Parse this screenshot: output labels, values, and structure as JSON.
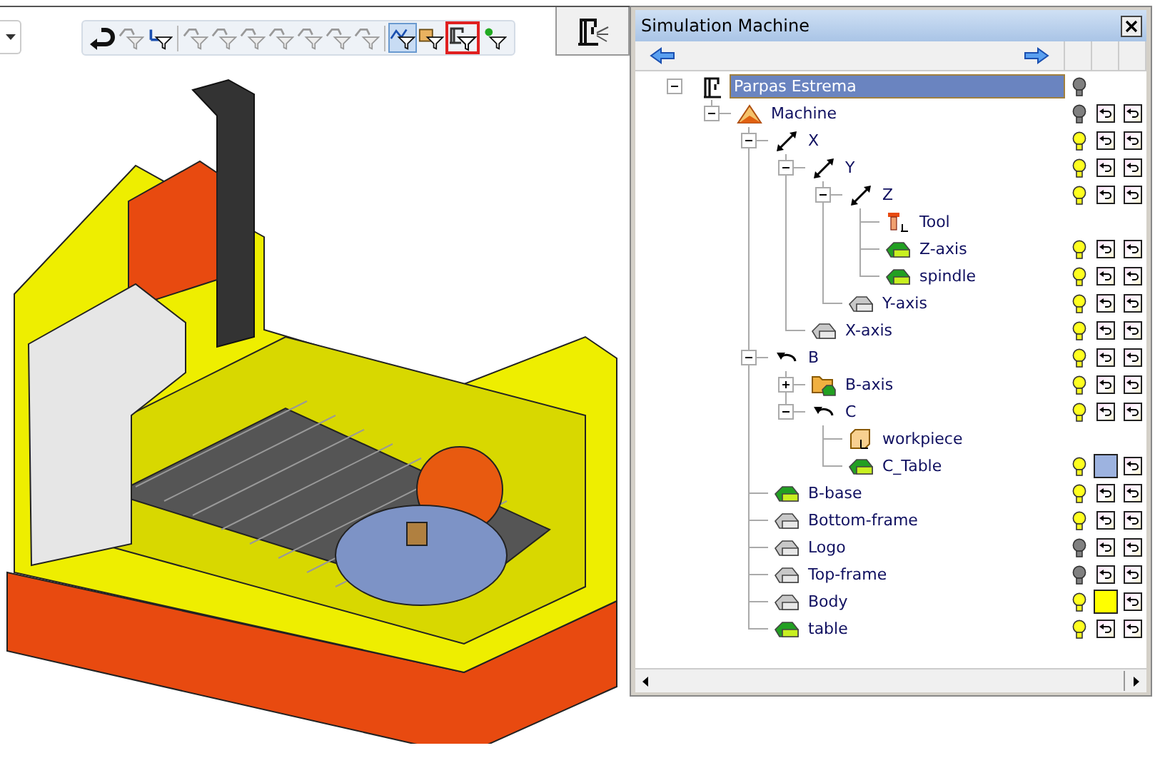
{
  "toolbar": {
    "buttons": [
      {
        "kind": "undo",
        "disabled": false,
        "pressed": false,
        "highlighted": false
      },
      {
        "kind": "filter",
        "disabled": true,
        "pressed": false,
        "highlighted": false
      },
      {
        "kind": "filter-axes",
        "disabled": false,
        "pressed": false,
        "highlighted": false
      },
      {
        "kind": "separator"
      },
      {
        "kind": "filter",
        "disabled": true,
        "pressed": false,
        "highlighted": false
      },
      {
        "kind": "filter",
        "disabled": true,
        "pressed": false,
        "highlighted": false
      },
      {
        "kind": "filter",
        "disabled": true,
        "pressed": false,
        "highlighted": false
      },
      {
        "kind": "filter",
        "disabled": true,
        "pressed": false,
        "highlighted": false
      },
      {
        "kind": "filter",
        "disabled": true,
        "pressed": false,
        "highlighted": false
      },
      {
        "kind": "filter",
        "disabled": true,
        "pressed": false,
        "highlighted": false
      },
      {
        "kind": "filter",
        "disabled": true,
        "pressed": false,
        "highlighted": false
      },
      {
        "kind": "separator"
      },
      {
        "kind": "filter-path",
        "disabled": false,
        "pressed": true,
        "highlighted": false
      },
      {
        "kind": "filter-box",
        "disabled": false,
        "pressed": false,
        "highlighted": false
      },
      {
        "kind": "filter-machine",
        "disabled": false,
        "pressed": false,
        "highlighted": true
      },
      {
        "kind": "filter-point",
        "disabled": false,
        "pressed": false,
        "highlighted": false
      }
    ]
  },
  "panel": {
    "title": "Simulation Machine",
    "tree": [
      {
        "label": "Parpas Estrema",
        "kind": "machine",
        "selected": true,
        "expanded": true,
        "bulb": true,
        "lit": false,
        "controls": false,
        "children": [
          {
            "label": "Machine",
            "kind": "assembly",
            "selected": false,
            "expanded": true,
            "bulb": true,
            "lit": false,
            "controls": true,
            "children": [
              {
                "label": "X",
                "kind": "linear-axis",
                "selected": false,
                "expanded": true,
                "bulb": true,
                "lit": true,
                "controls": true,
                "children": [
                  {
                    "label": "Y",
                    "kind": "linear-axis",
                    "selected": false,
                    "expanded": true,
                    "bulb": true,
                    "lit": true,
                    "controls": true,
                    "children": [
                      {
                        "label": "Z",
                        "kind": "linear-axis",
                        "selected": false,
                        "expanded": true,
                        "bulb": true,
                        "lit": true,
                        "controls": true,
                        "children": [
                          {
                            "label": "Tool",
                            "kind": "tool",
                            "selected": false,
                            "bulb": false,
                            "controls": false
                          },
                          {
                            "label": "Z-axis",
                            "kind": "solid",
                            "selected": false,
                            "bulb": true,
                            "lit": true,
                            "controls": true
                          },
                          {
                            "label": "spindle",
                            "kind": "solid",
                            "selected": false,
                            "bulb": true,
                            "lit": true,
                            "controls": true
                          }
                        ]
                      },
                      {
                        "label": "Y-axis",
                        "kind": "solid-dim",
                        "selected": false,
                        "bulb": true,
                        "lit": true,
                        "controls": true
                      }
                    ]
                  },
                  {
                    "label": "X-axis",
                    "kind": "solid-dim",
                    "selected": false,
                    "bulb": true,
                    "lit": true,
                    "controls": true
                  }
                ]
              },
              {
                "label": "B",
                "kind": "rotary-axis",
                "selected": false,
                "expanded": true,
                "bulb": true,
                "lit": true,
                "controls": true,
                "children": [
                  {
                    "label": "B-axis",
                    "kind": "folder",
                    "selected": false,
                    "expanded": false,
                    "bulb": true,
                    "lit": true,
                    "controls": true
                  },
                  {
                    "label": "C",
                    "kind": "rotary-axis",
                    "selected": false,
                    "expanded": true,
                    "bulb": true,
                    "lit": true,
                    "controls": true,
                    "children": [
                      {
                        "label": "workpiece",
                        "kind": "workpiece",
                        "selected": false,
                        "bulb": false,
                        "controls": false
                      },
                      {
                        "label": "C_Table",
                        "kind": "solid",
                        "selected": false,
                        "bulb": true,
                        "lit": true,
                        "controls": true,
                        "color": "#9db3e0"
                      }
                    ]
                  }
                ]
              },
              {
                "label": "B-base",
                "kind": "solid",
                "selected": false,
                "bulb": true,
                "lit": true,
                "controls": true
              },
              {
                "label": "Bottom-frame",
                "kind": "solid-dim",
                "selected": false,
                "bulb": true,
                "lit": true,
                "controls": true
              },
              {
                "label": "Logo",
                "kind": "solid-dim",
                "selected": false,
                "bulb": true,
                "lit": false,
                "controls": true
              },
              {
                "label": "Top-frame",
                "kind": "solid-dim",
                "selected": false,
                "bulb": true,
                "lit": false,
                "controls": true
              },
              {
                "label": "Body",
                "kind": "solid-dim",
                "selected": false,
                "bulb": true,
                "lit": true,
                "controls": true,
                "color": "#ffff00"
              },
              {
                "label": "table",
                "kind": "solid",
                "selected": false,
                "bulb": true,
                "lit": true,
                "controls": true
              }
            ]
          }
        ]
      }
    ]
  }
}
